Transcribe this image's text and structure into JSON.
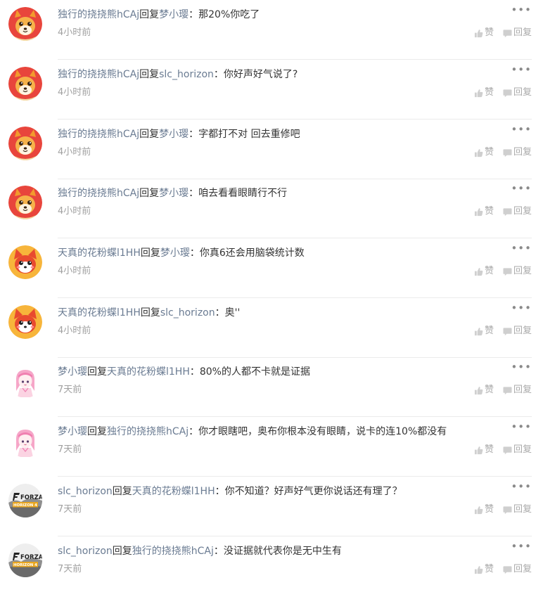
{
  "comments": [
    {
      "user": "独行的挠挠熊hCAj",
      "reply_word": "回复",
      "target": "梦小璎",
      "colon": "：",
      "text": "那20%你吃了",
      "time": "4小时前",
      "avatar": "orange-bear",
      "more": "•••",
      "like_label": "赞",
      "reply_label": "回复"
    },
    {
      "user": "独行的挠挠熊hCAj",
      "reply_word": "回复",
      "target": "slc_horizon",
      "colon": "：",
      "text": "你好声好气说了?",
      "time": "4小时前",
      "avatar": "orange-bear",
      "more": "•••",
      "like_label": "赞",
      "reply_label": "回复"
    },
    {
      "user": "独行的挠挠熊hCAj",
      "reply_word": "回复",
      "target": "梦小璎",
      "colon": "：",
      "text": "字都打不对 回去重修吧",
      "time": "4小时前",
      "avatar": "orange-bear",
      "more": "•••",
      "like_label": "赞",
      "reply_label": "回复"
    },
    {
      "user": "独行的挠挠熊hCAj",
      "reply_word": "回复",
      "target": "梦小璎",
      "colon": "：",
      "text": "咱去看看眼睛行不行",
      "time": "4小时前",
      "avatar": "orange-bear",
      "more": "•••",
      "like_label": "赞",
      "reply_label": "回复"
    },
    {
      "user": "天真的花粉蝶l1HH",
      "reply_word": "回复",
      "target": "梦小璎",
      "colon": "：",
      "text": "你真6还会用脑袋统计数",
      "time": "4小时前",
      "avatar": "red-fox",
      "more": "•••",
      "like_label": "赞",
      "reply_label": "回复"
    },
    {
      "user": "天真的花粉蝶l1HH",
      "reply_word": "回复",
      "target": "slc_horizon",
      "colon": "：",
      "text": "奥''",
      "time": "4小时前",
      "avatar": "red-fox",
      "more": "•••",
      "like_label": "赞",
      "reply_label": "回复"
    },
    {
      "user": "梦小璎",
      "reply_word": "回复",
      "target": "天真的花粉蝶l1HH",
      "colon": "：",
      "text": "80%的人都不卡就是证据",
      "time": "7天前",
      "avatar": "anime-girl",
      "more": "•••",
      "like_label": "赞",
      "reply_label": "回复"
    },
    {
      "user": "梦小璎",
      "reply_word": "回复",
      "target": "独行的挠挠熊hCAj",
      "colon": "：",
      "text": "你才眼瞎吧，奥布你根本没有眼睛，说卡的连10%都没有",
      "time": "7天前",
      "avatar": "anime-girl",
      "more": "•••",
      "like_label": "赞",
      "reply_label": "回复"
    },
    {
      "user": "slc_horizon",
      "reply_word": "回复",
      "target": "天真的花粉蝶l1HH",
      "colon": "：",
      "text": "你不知道？好声好气更你说话还有理了？",
      "time": "7天前",
      "avatar": "forza",
      "more": "•••",
      "like_label": "赞",
      "reply_label": "回复"
    },
    {
      "user": "slc_horizon",
      "reply_word": "回复",
      "target": "独行的挠挠熊hCAj",
      "colon": "：",
      "text": "没证据就代表你是无中生有",
      "time": "7天前",
      "avatar": "forza",
      "more": "•••",
      "like_label": "赞",
      "reply_label": "回复"
    }
  ],
  "logos": {
    "forza_top": "FORZA",
    "forza_bottom": "HORIZON 4"
  },
  "colors": {
    "username": "#6a7b92",
    "text": "#333333",
    "meta": "#a0a0a0",
    "divider": "#ebebeb"
  },
  "icons": {
    "like": "thumbs-up-icon",
    "reply": "speech-bubble-icon",
    "more": "more-dots-icon"
  }
}
